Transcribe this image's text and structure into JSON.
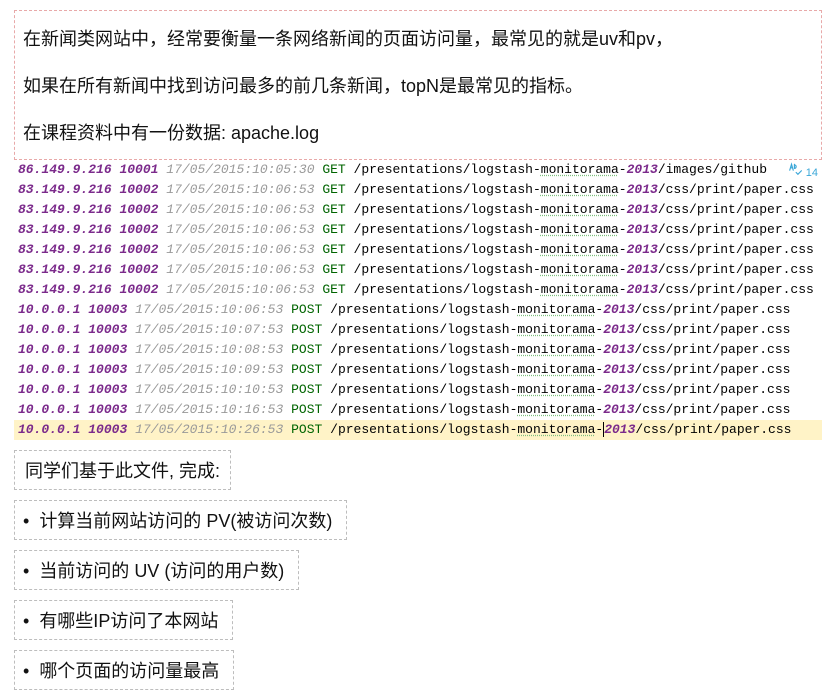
{
  "intro": {
    "p1": "在新闻类网站中，经常要衡量一条网络新闻的页面访问量，最常见的就是uv和pv，",
    "p2": "如果在所有新闻中找到访问最多的前几条新闻，topN是最常见的指标。",
    "p3": "在课程资料中有一份数据: apache.log"
  },
  "badge_num": "14",
  "log": [
    {
      "ip": "86.149.9.216",
      "port": "10001",
      "ts": "17/05/2015:10:05:30",
      "method": "GET",
      "path": "/presentations/logstash-monitorama-2013/images/github",
      "hl": false
    },
    {
      "ip": "83.149.9.216",
      "port": "10002",
      "ts": "17/05/2015:10:06:53",
      "method": "GET",
      "path": "/presentations/logstash-monitorama-2013/css/print/paper.css",
      "hl": false
    },
    {
      "ip": "83.149.9.216",
      "port": "10002",
      "ts": "17/05/2015:10:06:53",
      "method": "GET",
      "path": "/presentations/logstash-monitorama-2013/css/print/paper.css",
      "hl": false
    },
    {
      "ip": "83.149.9.216",
      "port": "10002",
      "ts": "17/05/2015:10:06:53",
      "method": "GET",
      "path": "/presentations/logstash-monitorama-2013/css/print/paper.css",
      "hl": false
    },
    {
      "ip": "83.149.9.216",
      "port": "10002",
      "ts": "17/05/2015:10:06:53",
      "method": "GET",
      "path": "/presentations/logstash-monitorama-2013/css/print/paper.css",
      "hl": false
    },
    {
      "ip": "83.149.9.216",
      "port": "10002",
      "ts": "17/05/2015:10:06:53",
      "method": "GET",
      "path": "/presentations/logstash-monitorama-2013/css/print/paper.css",
      "hl": false
    },
    {
      "ip": "83.149.9.216",
      "port": "10002",
      "ts": "17/05/2015:10:06:53",
      "method": "GET",
      "path": "/presentations/logstash-monitorama-2013/css/print/paper.css",
      "hl": false
    },
    {
      "ip": "10.0.0.1",
      "port": "10003",
      "ts": "17/05/2015:10:06:53",
      "method": "POST",
      "path": "/presentations/logstash-monitorama-2013/css/print/paper.css",
      "hl": false
    },
    {
      "ip": "10.0.0.1",
      "port": "10003",
      "ts": "17/05/2015:10:07:53",
      "method": "POST",
      "path": "/presentations/logstash-monitorama-2013/css/print/paper.css",
      "hl": false
    },
    {
      "ip": "10.0.0.1",
      "port": "10003",
      "ts": "17/05/2015:10:08:53",
      "method": "POST",
      "path": "/presentations/logstash-monitorama-2013/css/print/paper.css",
      "hl": false
    },
    {
      "ip": "10.0.0.1",
      "port": "10003",
      "ts": "17/05/2015:10:09:53",
      "method": "POST",
      "path": "/presentations/logstash-monitorama-2013/css/print/paper.css",
      "hl": false
    },
    {
      "ip": "10.0.0.1",
      "port": "10003",
      "ts": "17/05/2015:10:10:53",
      "method": "POST",
      "path": "/presentations/logstash-monitorama-2013/css/print/paper.css",
      "hl": false
    },
    {
      "ip": "10.0.0.1",
      "port": "10003",
      "ts": "17/05/2015:10:16:53",
      "method": "POST",
      "path": "/presentations/logstash-monitorama-2013/css/print/paper.css",
      "hl": false
    },
    {
      "ip": "10.0.0.1",
      "port": "10003",
      "ts": "17/05/2015:10:26:53",
      "method": "POST",
      "path": "/presentations/logstash-monitorama-2013/css/print/paper.css",
      "hl": true
    }
  ],
  "subtitle": "同学们基于此文件, 完成:",
  "tasks": [
    "计算当前网站访问的 PV(被访问次数)",
    "当前访问的 UV (访问的用户数)",
    "有哪些IP访问了本网站",
    "哪个页面的访问量最高"
  ]
}
